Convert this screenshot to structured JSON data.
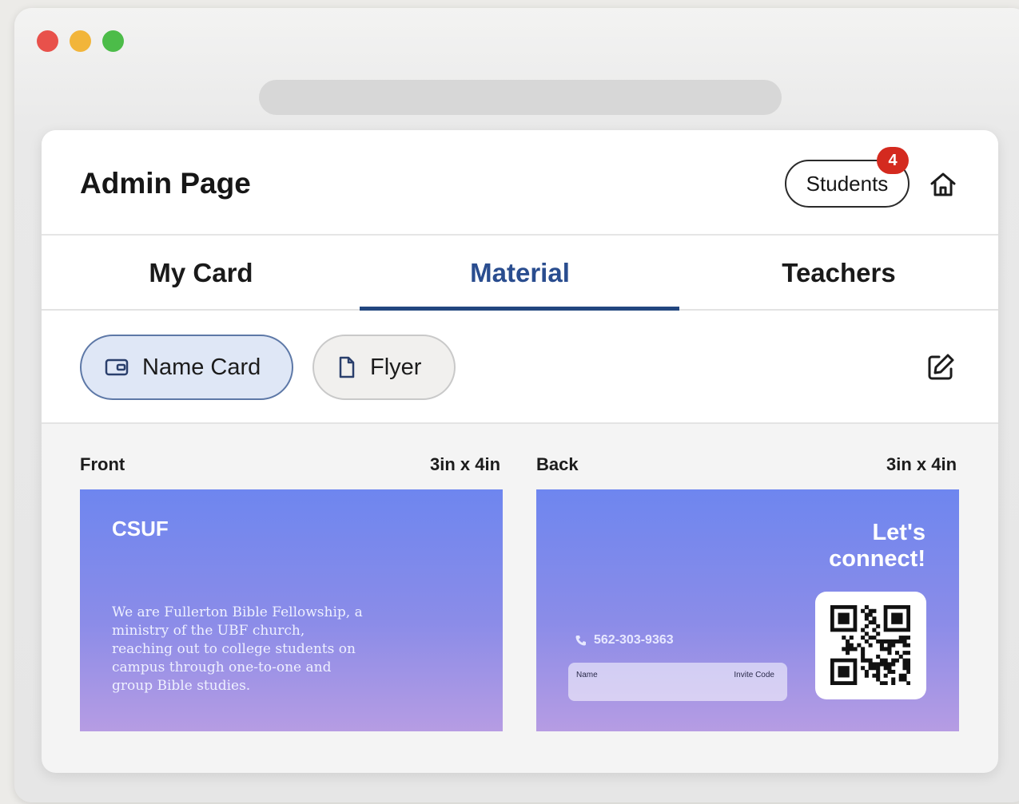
{
  "header": {
    "title": "Admin Page",
    "students_label": "Students",
    "students_badge": "4",
    "home_icon": "home-icon"
  },
  "tabs": [
    {
      "label": "My Card",
      "active": false
    },
    {
      "label": "Material",
      "active": true
    },
    {
      "label": "Teachers",
      "active": false
    }
  ],
  "filters": {
    "name_card_label": "Name Card",
    "name_card_icon": "card-icon",
    "flyer_label": "Flyer",
    "flyer_icon": "document-icon",
    "edit_icon": "edit-icon",
    "selected": "Name Card"
  },
  "preview": {
    "front": {
      "label": "Front",
      "size": "3in x 4in",
      "title": "CSUF",
      "body": "We are Fullerton Bible Fellowship, a ministry of the UBF church, reaching out to college students on campus through one-to-one and group Bible studies."
    },
    "back": {
      "label": "Back",
      "size": "3in x 4in",
      "headline": "Let's connect!",
      "phone": "562-303-9363",
      "name_label": "Name",
      "invite_label": "Invite Code",
      "qr_icon": "qr-code-icon"
    }
  },
  "colors": {
    "active_tab": "#2a4d8f",
    "underline": "#22467f",
    "badge": "#d42a1f",
    "card_gradient_top": "#6e86ef",
    "card_gradient_bottom": "#b69ce3",
    "chip_selected_bg": "#dfe7f6"
  }
}
